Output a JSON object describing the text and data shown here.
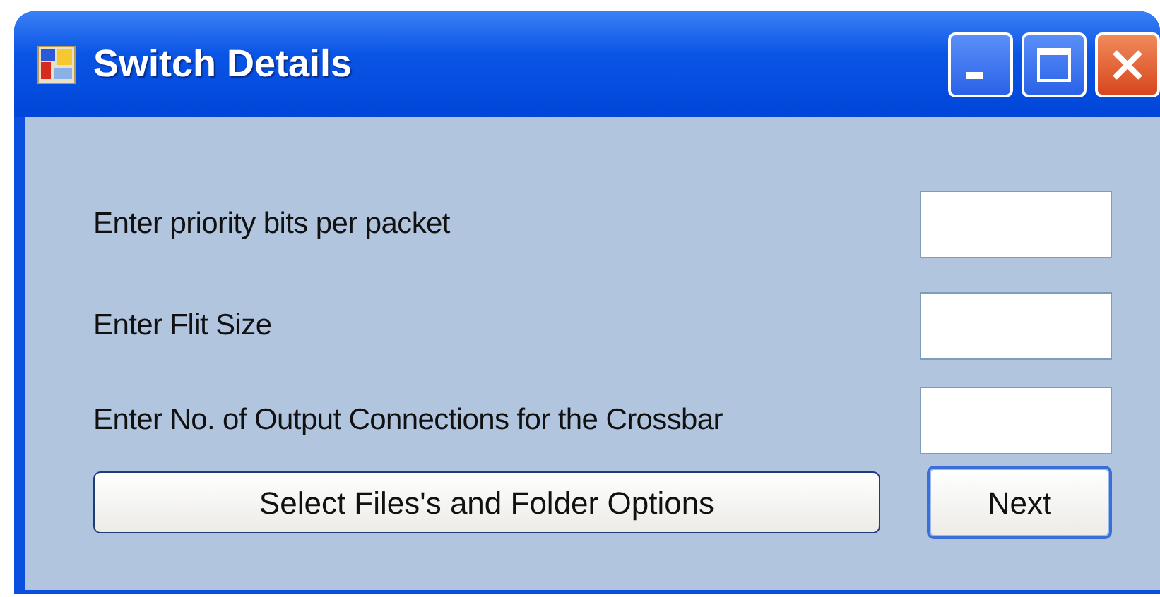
{
  "window": {
    "title": "Switch Details"
  },
  "fields": [
    {
      "label": "Enter priority bits per packet"
    },
    {
      "label": "Enter Flit Size"
    },
    {
      "label": "Enter No. of Output Connections for the Crossbar"
    }
  ],
  "buttons": [
    {
      "label": "Select Files's and Folder Options",
      "default": false
    },
    {
      "label": "Next",
      "default": true
    }
  ]
}
